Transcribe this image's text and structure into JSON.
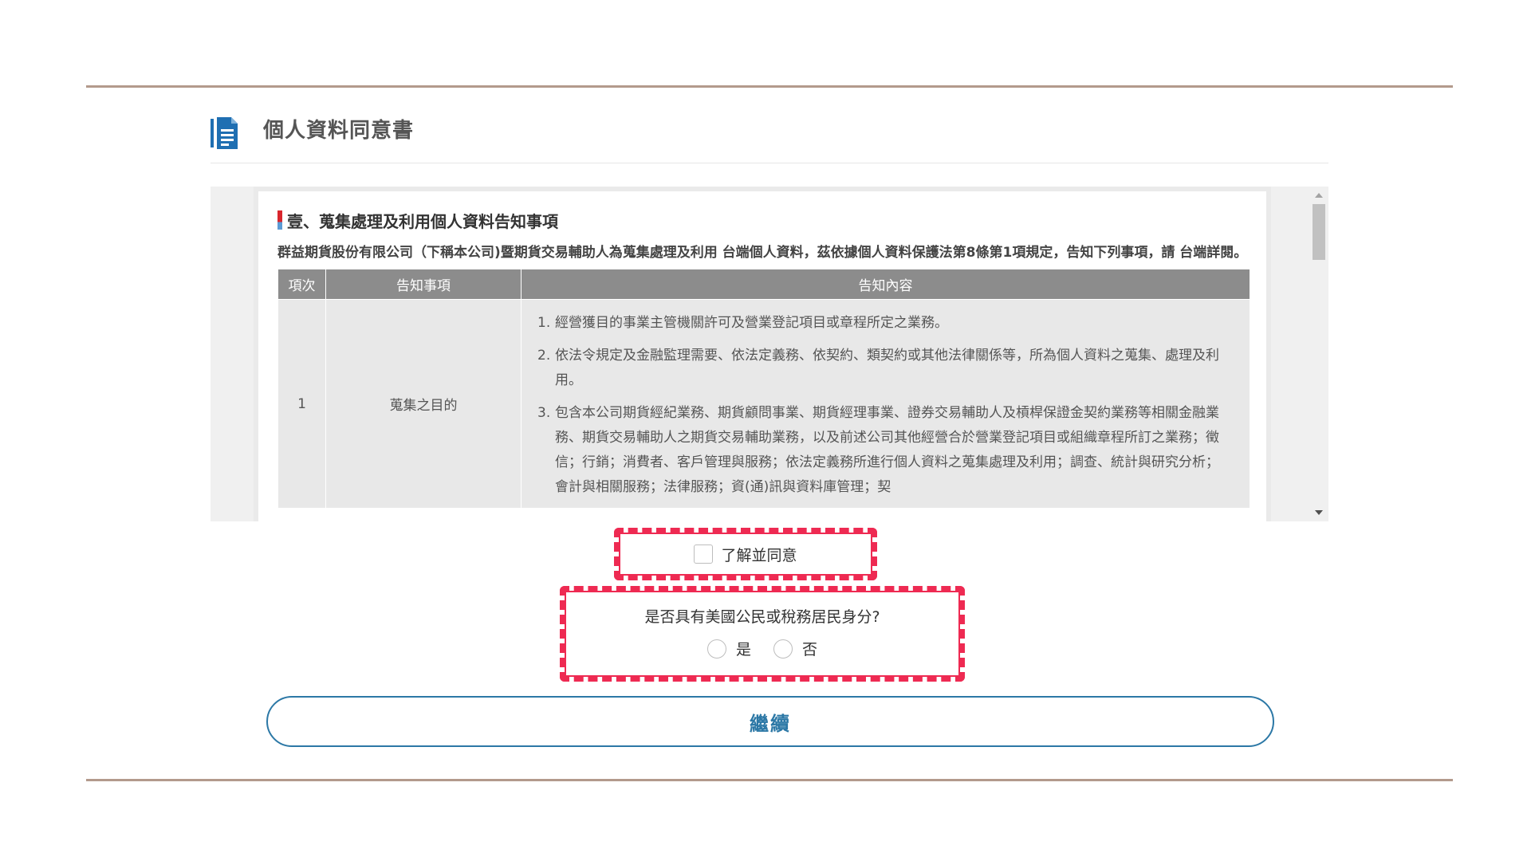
{
  "page": {
    "title": "個人資料同意書",
    "icon": "document-icon"
  },
  "notice": {
    "section_title": "壹、蒐集處理及利用個人資料告知事項",
    "intro": "群益期貨股份有限公司（下稱本公司)暨期貨交易輔助人為蒐集處理及利用 台端個人資料，茲依據個人資料保護法第8條第1項規定，告知下列事項，請 台端詳閱。",
    "table": {
      "headers": [
        "項次",
        "告知事項",
        "告知內容"
      ],
      "rows": [
        {
          "index": "1",
          "item": "蒐集之目的",
          "contents": [
            {
              "num": "1.",
              "text": "經營獲目的事業主管機關許可及營業登記項目或章程所定之業務。"
            },
            {
              "num": "2.",
              "text": "依法令規定及金融監理需要、依法定義務、依契約、類契約或其他法律關係等，所為個人資料之蒐集、處理及利用。"
            },
            {
              "num": "3.",
              "text": "包含本公司期貨經紀業務、期貨顧問事業、期貨經理事業、證券交易輔助人及槓桿保證金契約業務等相關金融業務、期貨交易輔助人之期貨交易輔助業務，以及前述公司其他經營合於營業登記項目或組織章程所訂之業務；徵信；行銷；消費者、客戶管理與服務；依法定義務所進行個人資料之蒐集處理及利用；調查、統計與研究分析；會計與相關服務；法律服務；資(通)訊與資料庫管理；契"
            }
          ]
        }
      ]
    }
  },
  "consent": {
    "label": "了解並同意",
    "checked": false
  },
  "us_person": {
    "question": "是否具有美國公民或稅務居民身分?",
    "options": [
      "是",
      "否"
    ],
    "selected": null
  },
  "continue_button": {
    "label": "繼續"
  },
  "colors": {
    "accent": "#2c78a6",
    "highlight_border": "#ee2a52",
    "table_header": "#8c8c8c",
    "rule": "#b39a8c"
  }
}
